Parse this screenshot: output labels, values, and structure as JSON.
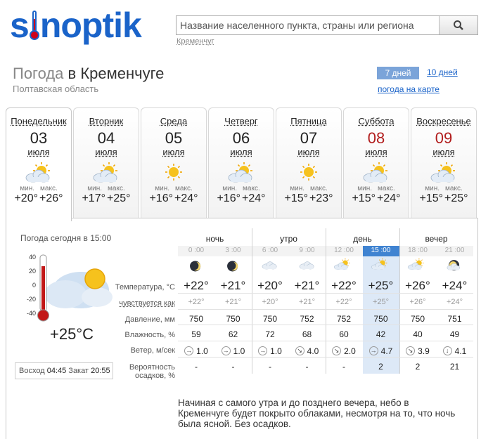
{
  "logo": {
    "text_before": "s",
    "text_after": "noptik"
  },
  "search": {
    "placeholder": "Название населенного пункта, страны или региона",
    "recent": "Кременчуг"
  },
  "heading": {
    "prefix": "Погода",
    "city": "в Кременчуге",
    "region": "Полтавская область"
  },
  "tabs": {
    "week": "7 дней",
    "ten": "10 дней",
    "map": "погода на карте"
  },
  "labels": {
    "min": "мин.",
    "max": "макс."
  },
  "days": [
    {
      "name": "Понедельник",
      "date": "03",
      "month": "июля",
      "min": "+20°",
      "max": "+26°",
      "weekend": false,
      "icon": "partly-cloudy-icon"
    },
    {
      "name": "Вторник",
      "date": "04",
      "month": "июля",
      "min": "+17°",
      "max": "+25°",
      "weekend": false,
      "icon": "partly-cloudy-icon"
    },
    {
      "name": "Среда",
      "date": "05",
      "month": "июля",
      "min": "+16°",
      "max": "+24°",
      "weekend": false,
      "icon": "sun-icon"
    },
    {
      "name": "Четверг",
      "date": "06",
      "month": "июля",
      "min": "+16°",
      "max": "+24°",
      "weekend": false,
      "icon": "partly-cloudy-icon"
    },
    {
      "name": "Пятница",
      "date": "07",
      "month": "июля",
      "min": "+15°",
      "max": "+23°",
      "weekend": false,
      "icon": "sun-icon"
    },
    {
      "name": "Суббота",
      "date": "08",
      "month": "июля",
      "min": "+15°",
      "max": "+24°",
      "weekend": true,
      "icon": "partly-cloudy-icon"
    },
    {
      "name": "Воскресенье",
      "date": "09",
      "month": "июля",
      "min": "+15°",
      "max": "+25°",
      "weekend": true,
      "icon": "partly-cloudy-icon"
    }
  ],
  "today": {
    "label": "Погода сегодня в 15:00",
    "scale": [
      "40",
      "20",
      "0",
      "-20",
      "-40"
    ],
    "temp": "+25°C",
    "sunrise_label": "Восход",
    "sunrise": "04:45",
    "sunset_label": "Закат",
    "sunset": "20:55"
  },
  "periods": [
    "ночь",
    "утро",
    "день",
    "вечер"
  ],
  "hours": [
    "0 :00",
    "3 :00",
    "6 :00",
    "9 :00",
    "12 :00",
    "15 :00",
    "18 :00",
    "21 :00"
  ],
  "row_labels": {
    "temp": "Температура, °C",
    "feels": "чувствуется как",
    "pressure": "Давление, мм",
    "humidity": "Влажность, %",
    "wind": "Ветер, м/сек",
    "precip_1": "Вероятность",
    "precip_2": "осадков, %"
  },
  "hourly": {
    "icons": [
      "moon-icon",
      "moon-icon",
      "cloud-icon",
      "cloud-icon",
      "cloud-sun-icon",
      "cloud-sun-icon",
      "cloud-sun-icon",
      "moon-cloud-icon"
    ],
    "temp": [
      "+22°",
      "+21°",
      "+20°",
      "+21°",
      "+22°",
      "+25°",
      "+26°",
      "+24°"
    ],
    "feels": [
      "+22°",
      "+21°",
      "+20°",
      "+21°",
      "+22°",
      "+25°",
      "+26°",
      "+24°"
    ],
    "pressure": [
      "750",
      "750",
      "750",
      "752",
      "752",
      "750",
      "750",
      "751"
    ],
    "humidity": [
      "59",
      "62",
      "72",
      "68",
      "60",
      "42",
      "40",
      "49"
    ],
    "wind_dir": [
      "→",
      "→",
      "→",
      "↘",
      "↘",
      "→",
      "↘",
      "↓"
    ],
    "wind": [
      "1.0",
      "1.0",
      "1.0",
      "4.0",
      "2.0",
      "4.7",
      "3.9",
      "4.1"
    ],
    "precip": [
      "-",
      "-",
      "-",
      "-",
      "-",
      "2",
      "2",
      "21"
    ]
  },
  "description": "Начиная с самого утра и до позднего вечера, небо в Кременчуге будет покрыто облаками, несмотря на то, что ночь была ясной. Без осадков.",
  "colors": {
    "brand": "#1a63c9",
    "weekend": "#b11c1c",
    "current_hour": "#3f83d1",
    "current_col": "#dde9f7"
  }
}
